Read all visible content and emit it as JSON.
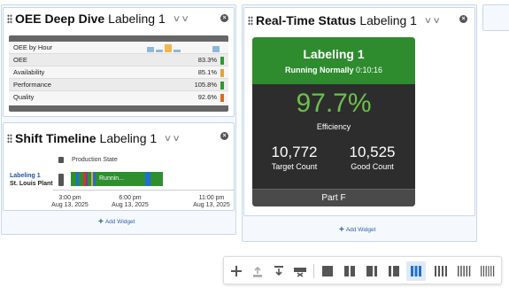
{
  "oee_widget": {
    "title_bold": "OEE Deep Dive",
    "title_normal": "Labeling 1",
    "chart_label": "OEE by Hour",
    "rows": [
      {
        "label": "OEE",
        "value": "83.3%",
        "color": "#2e9a2e"
      },
      {
        "label": "Availability",
        "value": "85.1%",
        "color": "#e8a43a"
      },
      {
        "label": "Performance",
        "value": "105.8%",
        "color": "#2e9a2e"
      },
      {
        "label": "Quality",
        "value": "92.6%",
        "color": "#e06a1c"
      }
    ]
  },
  "timeline_widget": {
    "title_bold": "Shift Timeline",
    "title_normal": "Labeling 1",
    "legend": "Production State",
    "asset_name": "Labeling 1",
    "asset_site": "St. Louis Plant",
    "bar_label": "Runnin...",
    "ticks": [
      {
        "time": "3:00 pm",
        "date": "Aug 13, 2025"
      },
      {
        "time": "6:00 pm",
        "date": "Aug 13, 2025"
      },
      {
        "time": "11:00 pm",
        "date": "Aug 13, 2025"
      }
    ]
  },
  "realtime_widget": {
    "title_bold": "Real-Time Status",
    "title_normal": "Labeling 1",
    "asset": "Labeling 1",
    "status": "Running Normally",
    "duration": "0:10:16",
    "efficiency_value": "97.7%",
    "efficiency_label": "Efficiency",
    "target_value": "10,772",
    "target_label": "Target Count",
    "good_value": "10,525",
    "good_label": "Good Count",
    "part": "Part F"
  },
  "add_widget_label": "Add Widget",
  "colors": {
    "running_green": "#2e8b2e",
    "efficiency_green": "#6cc04a",
    "accent_blue": "#1f6fd6"
  }
}
